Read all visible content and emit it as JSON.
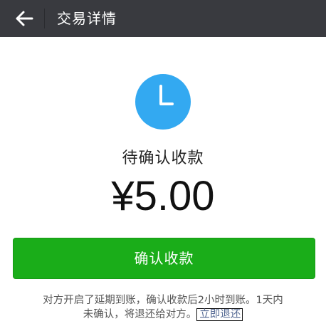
{
  "header": {
    "title": "交易详情",
    "back_icon": "arrow-left-icon"
  },
  "status": {
    "icon": "clock-icon",
    "icon_color": "#33a9f1",
    "label": "待确认收款"
  },
  "amount": "¥5.00",
  "confirm_button": {
    "label": "确认收款",
    "color": "#1aad19"
  },
  "notice": {
    "line1": "对方开启了延期到账，确认收款后2小时到账。1天内",
    "line2": "未确认，将退还给对方。",
    "refund_link": "立即退还",
    "link_color": "#576b95"
  }
}
